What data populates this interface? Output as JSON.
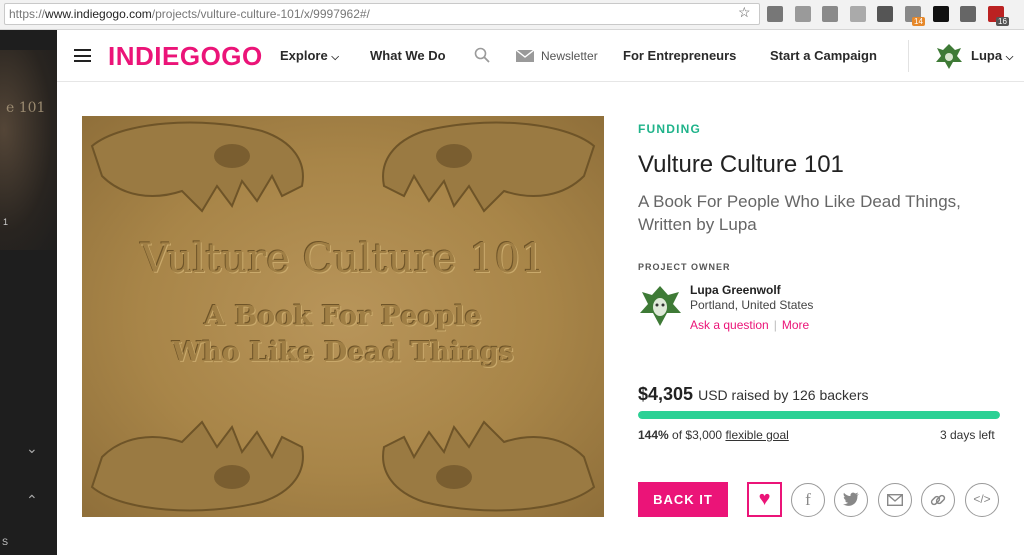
{
  "browser": {
    "url_scheme": "https://",
    "url_host": "www.indiegogo.com",
    "url_path": "/projects/vulture-culture-101/x/9997962#/",
    "ext_badge_1": "14",
    "ext_badge_2": "16"
  },
  "left_strip": {
    "partial_text": "1",
    "partial_title": "e 101",
    "partial_bottom": "S"
  },
  "header": {
    "logo": "INDIEGOGO",
    "explore": "Explore",
    "what_we_do": "What We Do",
    "newsletter": "Newsletter",
    "for_entrepreneurs": "For Entrepreneurs",
    "start_campaign": "Start a Campaign",
    "user": "Lupa"
  },
  "hero": {
    "title_line": "Vulture Culture 101",
    "sub_line_1": "A Book For People",
    "sub_line_2": "Who Like Dead Things"
  },
  "project": {
    "status": "FUNDING",
    "title": "Vulture Culture 101",
    "tagline": "A Book For People Who Like Dead Things, Written by Lupa",
    "owner_label": "PROJECT OWNER",
    "owner_name": "Lupa Greenwolf",
    "owner_location": "Portland, United States",
    "ask_question": "Ask a question",
    "more": "More"
  },
  "funding": {
    "amount": "$4,305",
    "raised_text": "USD raised by 126 backers",
    "progress_percent": 100,
    "percent_text": "144%",
    "goal_text": "of $3,000",
    "goal_type": "flexible goal",
    "days_left": "3 days left"
  },
  "actions": {
    "back_it": "BACK IT"
  },
  "colors": {
    "brand": "#eb1478",
    "funding_green": "#1fb38a",
    "progress": "#2bd195"
  },
  "icons": [
    "menu-icon",
    "chevron-down-icon",
    "search-icon",
    "mail-icon",
    "heart-icon",
    "facebook-icon",
    "twitter-icon",
    "email-icon",
    "link-icon",
    "embed-icon"
  ]
}
